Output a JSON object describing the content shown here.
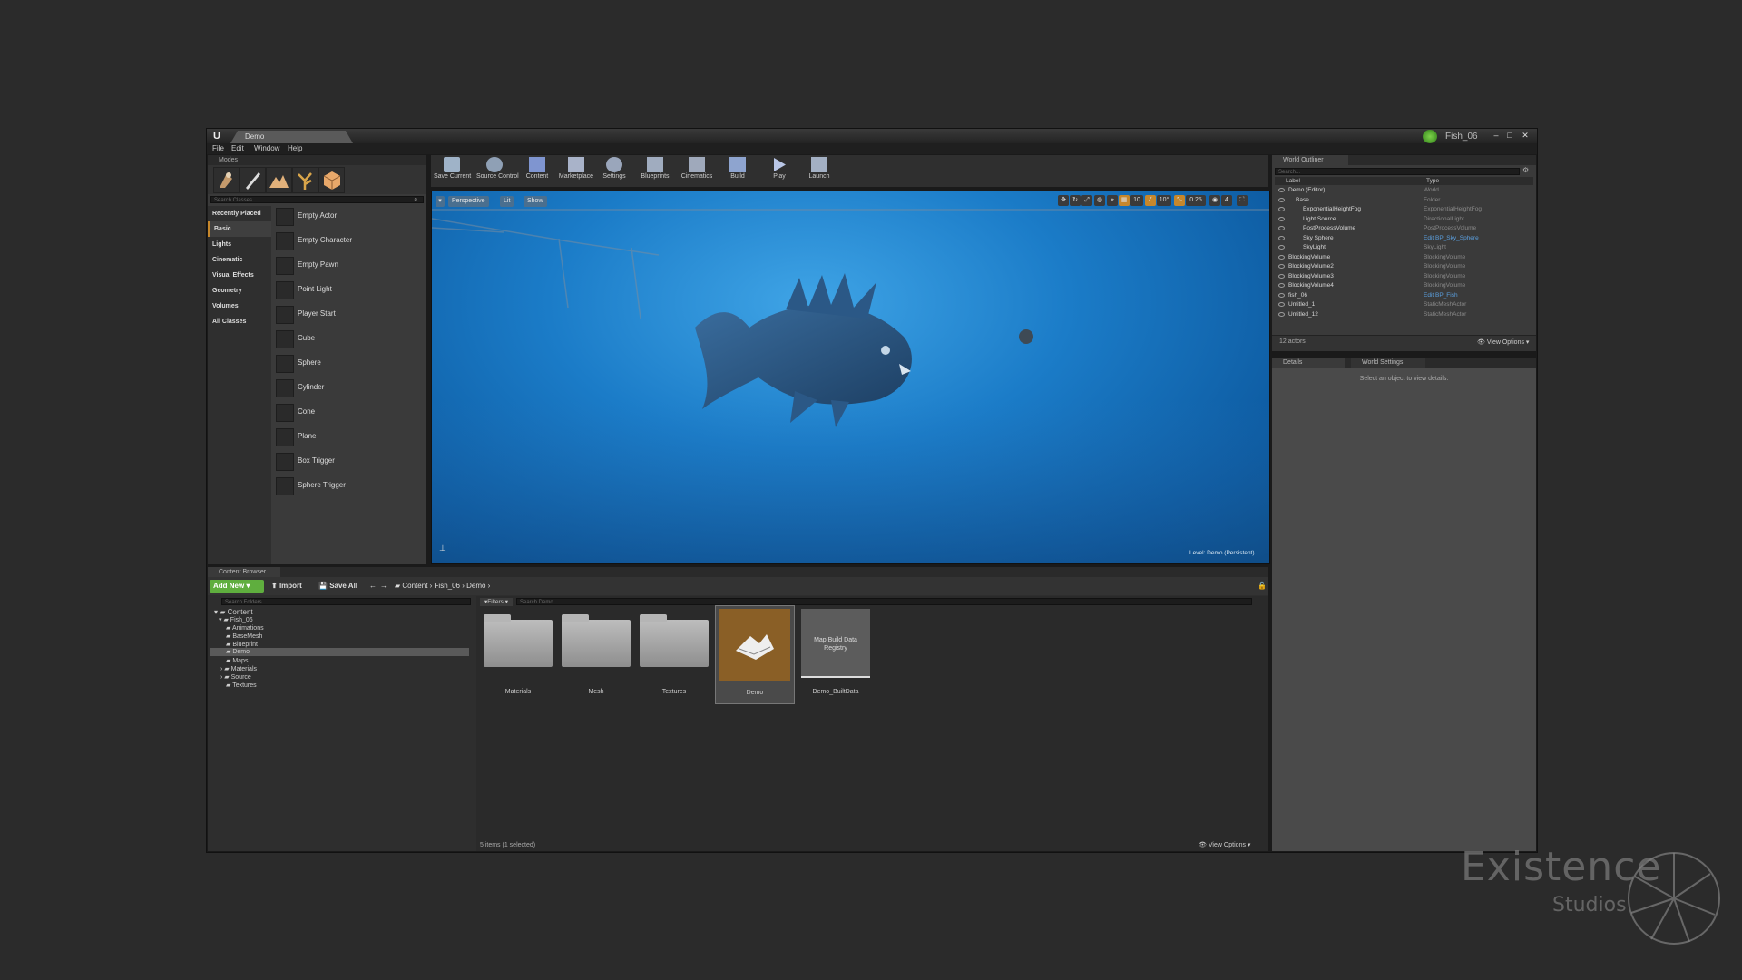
{
  "window": {
    "doc_tab": "Demo",
    "project_name": "Fish_06",
    "menu": [
      "File",
      "Edit",
      "Window",
      "Help"
    ]
  },
  "modes": {
    "tab": "Modes",
    "search_placeholder": "Search Classes",
    "categories": [
      "Recently Placed",
      "Basic",
      "Lights",
      "Cinematic",
      "Visual Effects",
      "Geometry",
      "Volumes",
      "All Classes"
    ],
    "items": [
      "Empty Actor",
      "Empty Character",
      "Empty Pawn",
      "Point Light",
      "Player Start",
      "Cube",
      "Sphere",
      "Cylinder",
      "Cone",
      "Plane",
      "Box Trigger",
      "Sphere Trigger"
    ]
  },
  "toolbar": {
    "buttons": [
      "Save Current",
      "Source Control",
      "Content",
      "Marketplace",
      "Settings",
      "Blueprints",
      "Cinematics",
      "Build",
      "Play",
      "Launch"
    ]
  },
  "viewport": {
    "perspective": "Perspective",
    "lit": "Lit",
    "show": "Show",
    "grid_snap": "10",
    "rot_snap": "10°",
    "scale_snap": "0.25",
    "cam_speed": "4",
    "level_text": "Level:  Demo (Persistent)"
  },
  "outliner": {
    "tab": "World Outliner",
    "search_placeholder": "Search...",
    "col_label": "Label",
    "col_type": "Type",
    "rows": [
      {
        "label": "Demo (Editor)",
        "type": "World",
        "link": false
      },
      {
        "label": "Base",
        "type": "Folder",
        "link": false
      },
      {
        "label": "ExponentialHeightFog",
        "type": "ExponentialHeightFog",
        "link": false
      },
      {
        "label": "Light Source",
        "type": "DirectionalLight",
        "link": false
      },
      {
        "label": "PostProcessVolume",
        "type": "PostProcessVolume",
        "link": false
      },
      {
        "label": "Sky Sphere",
        "type": "Edit BP_Sky_Sphere",
        "link": true
      },
      {
        "label": "SkyLight",
        "type": "SkyLight",
        "link": false
      },
      {
        "label": "BlockingVolume",
        "type": "BlockingVolume",
        "link": false
      },
      {
        "label": "BlockingVolume2",
        "type": "BlockingVolume",
        "link": false
      },
      {
        "label": "BlockingVolume3",
        "type": "BlockingVolume",
        "link": false
      },
      {
        "label": "BlockingVolume4",
        "type": "BlockingVolume",
        "link": false
      },
      {
        "label": "fish_06",
        "type": "Edit BP_Fish",
        "link": true
      },
      {
        "label": "Untitled_1",
        "type": "StaticMeshActor",
        "link": false
      },
      {
        "label": "Untitled_12",
        "type": "StaticMeshActor",
        "link": false
      }
    ],
    "count": "12 actors",
    "view_options": "View Options"
  },
  "details": {
    "tab": "Details",
    "tab2": "World Settings",
    "empty_text": "Select an object to view details."
  },
  "content_browser": {
    "tab": "Content Browser",
    "add_new": "Add New",
    "import": "Import",
    "save_all": "Save All",
    "breadcrumb": [
      "Content",
      "Fish_06",
      "Demo"
    ],
    "search_folders": "Search Folders",
    "filters": "Filters",
    "search_assets": "Search Demo",
    "tree": [
      "Content",
      "Fish_06",
      "Animations",
      "BaseMesh",
      "Blueprint",
      "Demo",
      "Maps",
      "Materials",
      "Source",
      "Textures"
    ],
    "assets": [
      {
        "label": "Materials",
        "kind": "folder"
      },
      {
        "label": "Mesh",
        "kind": "folder"
      },
      {
        "label": "Textures",
        "kind": "folder"
      },
      {
        "label": "Demo",
        "kind": "level"
      },
      {
        "label": "Demo_BuiltData",
        "kind": "data",
        "thumb_text": "Map Build Data Registry"
      }
    ],
    "status": "5 items (1 selected)",
    "view_options": "View Options"
  },
  "watermark": {
    "line1": "Existence",
    "line2": "Studios"
  },
  "colors": {
    "accent_green": "#5fae3e",
    "selection_orange": "#8a5f26",
    "link_blue": "#5ba0e0"
  }
}
